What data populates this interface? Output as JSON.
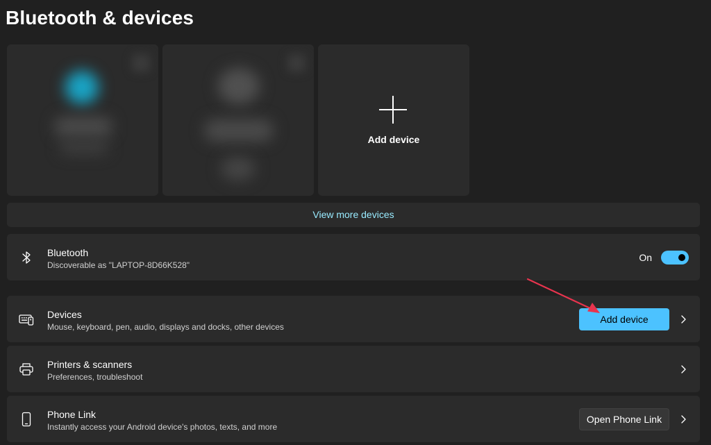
{
  "page": {
    "title": "Bluetooth & devices"
  },
  "device_tiles": {
    "add_device_label": "Add device"
  },
  "view_more": {
    "label": "View more devices"
  },
  "bluetooth": {
    "title": "Bluetooth",
    "subtitle": "Discoverable as \"LAPTOP-8D66K528\"",
    "toggle_state": "On",
    "toggle_on": true
  },
  "devices": {
    "title": "Devices",
    "subtitle": "Mouse, keyboard, pen, audio, displays and docks, other devices",
    "button_label": "Add device"
  },
  "printers": {
    "title": "Printers & scanners",
    "subtitle": "Preferences, troubleshoot"
  },
  "phone_link": {
    "title": "Phone Link",
    "subtitle": "Instantly access your Android device's photos, texts, and more",
    "button_label": "Open Phone Link"
  },
  "icons": {
    "bluetooth": "bluetooth-icon",
    "devices": "keyboard-icon",
    "printers": "printer-icon",
    "phone": "phone-icon",
    "add": "plus-icon",
    "chevron": "chevron-right-icon"
  },
  "colors": {
    "accent": "#4cc2ff",
    "link": "#99ebff",
    "card": "#2b2b2b",
    "background": "#202020",
    "annotation_arrow": "#e8344e"
  }
}
